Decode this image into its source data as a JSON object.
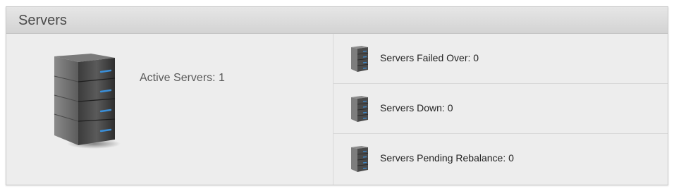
{
  "panel": {
    "title": "Servers"
  },
  "active": {
    "label": "Active Servers: 1",
    "icon": "server-tower-icon"
  },
  "statuses": [
    {
      "label": "Servers Failed Over: 0",
      "icon": "server-icon"
    },
    {
      "label": "Servers Down: 0",
      "icon": "server-icon"
    },
    {
      "label": "Servers Pending Rebalance: 0",
      "icon": "server-icon"
    }
  ],
  "colors": {
    "server_led": "#3a8fd9",
    "header_bg": "#d9d9d9",
    "panel_bg": "#ededed"
  }
}
